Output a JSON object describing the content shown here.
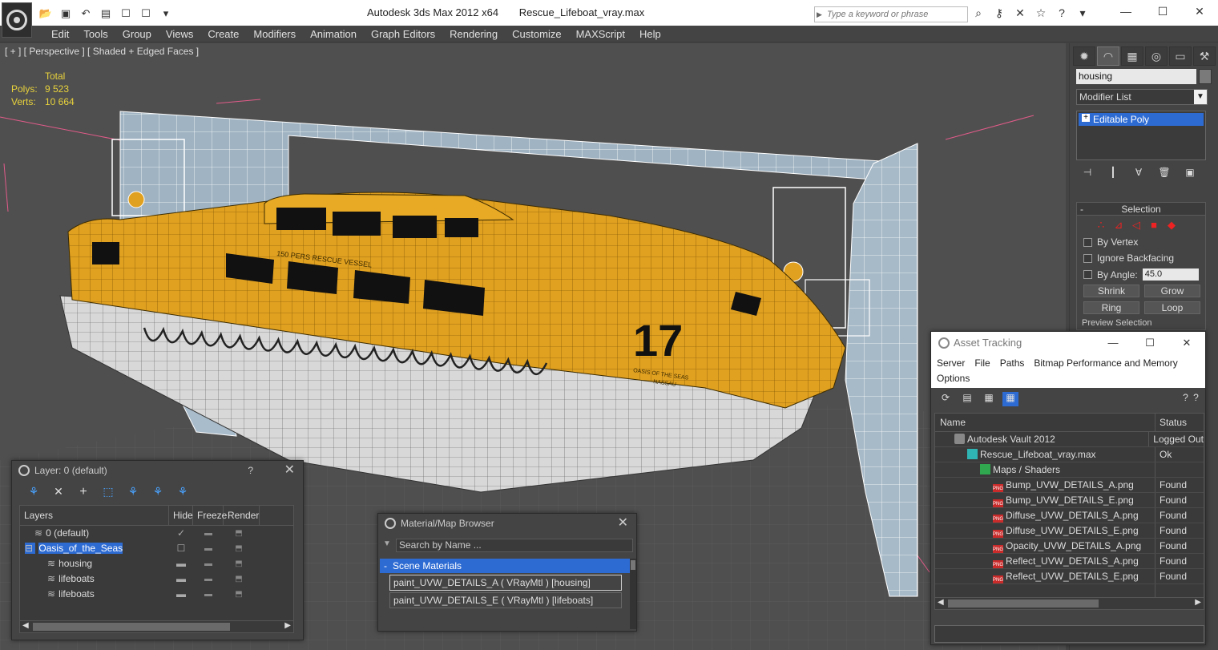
{
  "window": {
    "app_title": "Autodesk 3ds Max  2012 x64",
    "file_name": "Rescue_Lifeboat_vray.max",
    "search_placeholder": "Type a keyword or phrase",
    "minimize": "—",
    "maximize": "☐",
    "close": "✕"
  },
  "menu": [
    "Edit",
    "Tools",
    "Group",
    "Views",
    "Create",
    "Modifiers",
    "Animation",
    "Graph Editors",
    "Rendering",
    "Customize",
    "MAXScript",
    "Help"
  ],
  "viewport": {
    "label": "[ + ] [ Perspective ] [ Shaded + Edged Faces ]",
    "stats_total": "Total",
    "polys_label": "Polys:",
    "polys_value": "9 523",
    "verts_label": "Verts:",
    "verts_value": "10 664",
    "boat_number": "17",
    "boat_text_1": "150 PERS  RESCUE VESSEL",
    "boat_text_2": "OASIS OF THE SEAS",
    "boat_text_3": "NASSAU"
  },
  "command_panel": {
    "object_name": "housing",
    "modifier_list": "Modifier List",
    "stack_item": "Editable Poly",
    "rollout_title": "Selection",
    "by_vertex": "By Vertex",
    "ignore_backfacing": "Ignore Backfacing",
    "by_angle": "By Angle:",
    "angle_value": "45.0",
    "shrink": "Shrink",
    "grow": "Grow",
    "ring": "Ring",
    "loop": "Loop",
    "preview_selection": "Preview Selection"
  },
  "layer_dialog": {
    "title": "Layer: 0 (default)",
    "help": "?",
    "close": "✕",
    "columns": [
      "Layers",
      "Hide",
      "Freeze",
      "Render"
    ],
    "rows": [
      {
        "name": "0 (default)",
        "hide": "✓",
        "freeze": "▬",
        "render": "⬒"
      },
      {
        "name": "Oasis_of_the_Seas",
        "hide": "☐",
        "freeze": "▬",
        "render": "⬒"
      },
      {
        "name": "housing",
        "hide": "▬",
        "freeze": "▬",
        "render": "⬒"
      },
      {
        "name": "lifeboats",
        "hide": "▬",
        "freeze": "▬",
        "render": "⬒"
      },
      {
        "name": "lifeboats",
        "hide": "▬",
        "freeze": "▬",
        "render": "⬒"
      }
    ]
  },
  "material_browser": {
    "title": "Material/Map Browser",
    "close": "✕",
    "search_placeholder": "Search by Name ...",
    "group": "Scene Materials",
    "items": [
      "paint_UVW_DETAILS_A  ( VRayMtl ) [housing]",
      "paint_UVW_DETAILS_E  ( VRayMtl ) [lifeboats]"
    ]
  },
  "asset_tracking": {
    "title": "Asset Tracking",
    "menu": [
      "Server",
      "File",
      "Paths",
      "Bitmap Performance and Memory",
      "Options"
    ],
    "columns": [
      "Name",
      "Status"
    ],
    "rows": [
      {
        "name": "Autodesk Vault 2012",
        "status": "Logged Out",
        "icon": "vault-icon"
      },
      {
        "name": "Rescue_Lifeboat_vray.max",
        "status": "Ok",
        "icon": "max-file-icon"
      },
      {
        "name": "Maps / Shaders",
        "status": "",
        "icon": "maps-icon"
      },
      {
        "name": "Bump_UVW_DETAILS_A.png",
        "status": "Found",
        "icon": "png-icon"
      },
      {
        "name": "Bump_UVW_DETAILS_E.png",
        "status": "Found",
        "icon": "png-icon"
      },
      {
        "name": "Diffuse_UVW_DETAILS_A.png",
        "status": "Found",
        "icon": "png-icon"
      },
      {
        "name": "Diffuse_UVW_DETAILS_E.png",
        "status": "Found",
        "icon": "png-icon"
      },
      {
        "name": "Opacity_UVW_DETAILS_A.png",
        "status": "Found",
        "icon": "png-icon"
      },
      {
        "name": "Reflect_UVW_DETAILS_A.png",
        "status": "Found",
        "icon": "png-icon"
      },
      {
        "name": "Reflect_UVW_DETAILS_E.png",
        "status": "Found",
        "icon": "png-icon"
      }
    ]
  },
  "colors": {
    "accent_blue": "#2d6bd3",
    "stats_yellow": "#e8d23c",
    "hull_orange": "#e0a020",
    "hull_white": "#dcdcdc"
  }
}
